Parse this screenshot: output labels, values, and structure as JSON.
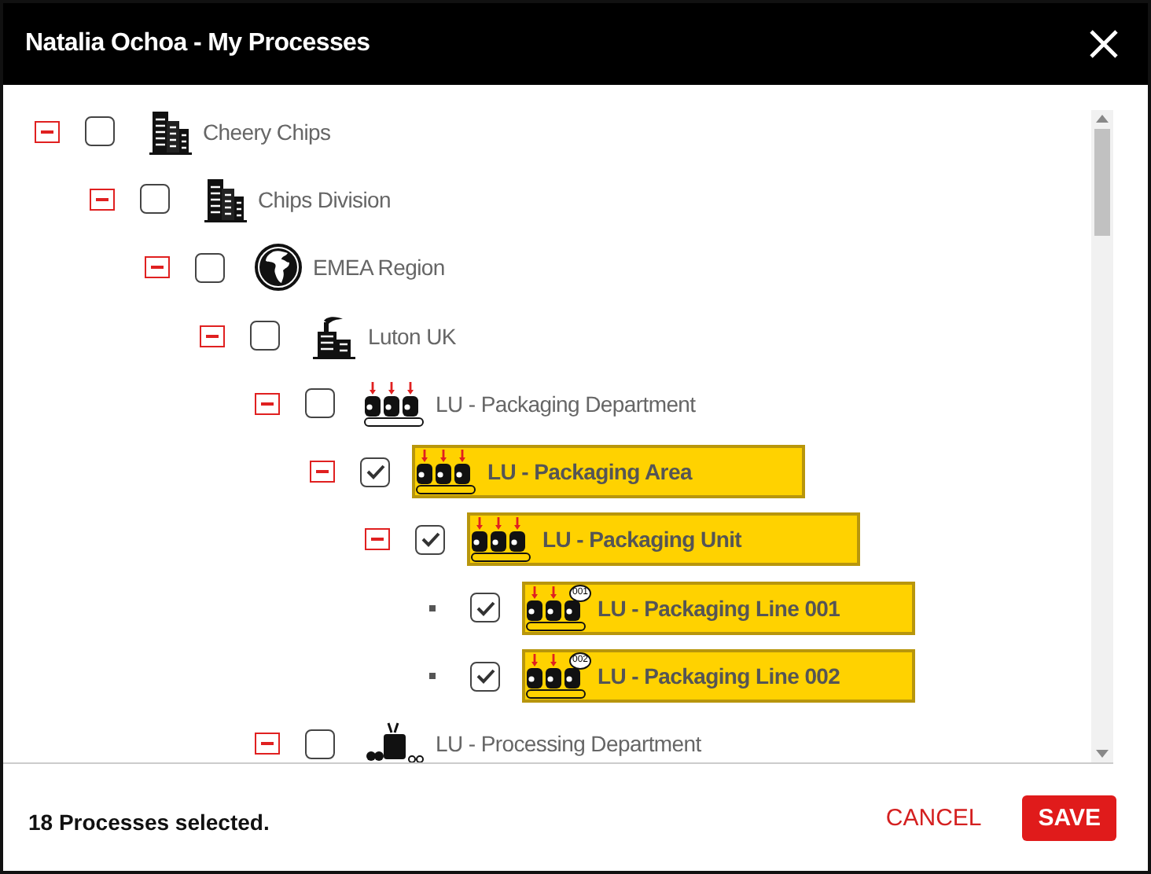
{
  "window": {
    "title": "Natalia Ochoa - My Processes"
  },
  "tree": [
    {
      "label": "Cheery Chips",
      "kind": "company",
      "checked": false,
      "expanded": true,
      "children": [
        {
          "label": "Chips Division",
          "kind": "company",
          "checked": false,
          "expanded": true,
          "children": [
            {
              "label": "EMEA Region",
              "kind": "region",
              "checked": false,
              "expanded": true,
              "children": [
                {
                  "label": "Luton UK",
                  "kind": "site",
                  "checked": false,
                  "expanded": true,
                  "children": [
                    {
                      "label": "LU - Packaging Department",
                      "kind": "packaging",
                      "checked": false,
                      "expanded": true,
                      "children": [
                        {
                          "label": "LU - Packaging Area",
                          "kind": "packaging",
                          "checked": true,
                          "expanded": true,
                          "children": [
                            {
                              "label": "LU - Packaging Unit",
                              "kind": "packaging",
                              "checked": true,
                              "expanded": true,
                              "children": [
                                {
                                  "label": "LU - Packaging Line 001",
                                  "kind": "line",
                                  "badge": "001",
                                  "checked": true
                                },
                                {
                                  "label": "LU - Packaging Line 002",
                                  "kind": "line",
                                  "badge": "002",
                                  "checked": true
                                }
                              ]
                            }
                          ]
                        }
                      ]
                    },
                    {
                      "label": "LU - Processing Department",
                      "kind": "processing",
                      "checked": false,
                      "expanded": true
                    }
                  ]
                }
              ]
            }
          ]
        }
      ]
    }
  ],
  "status": "18 Processes selected.",
  "buttons": [
    {
      "label": "CANCEL",
      "kind": "flat"
    },
    {
      "label": "SAVE",
      "kind": "raised"
    }
  ]
}
